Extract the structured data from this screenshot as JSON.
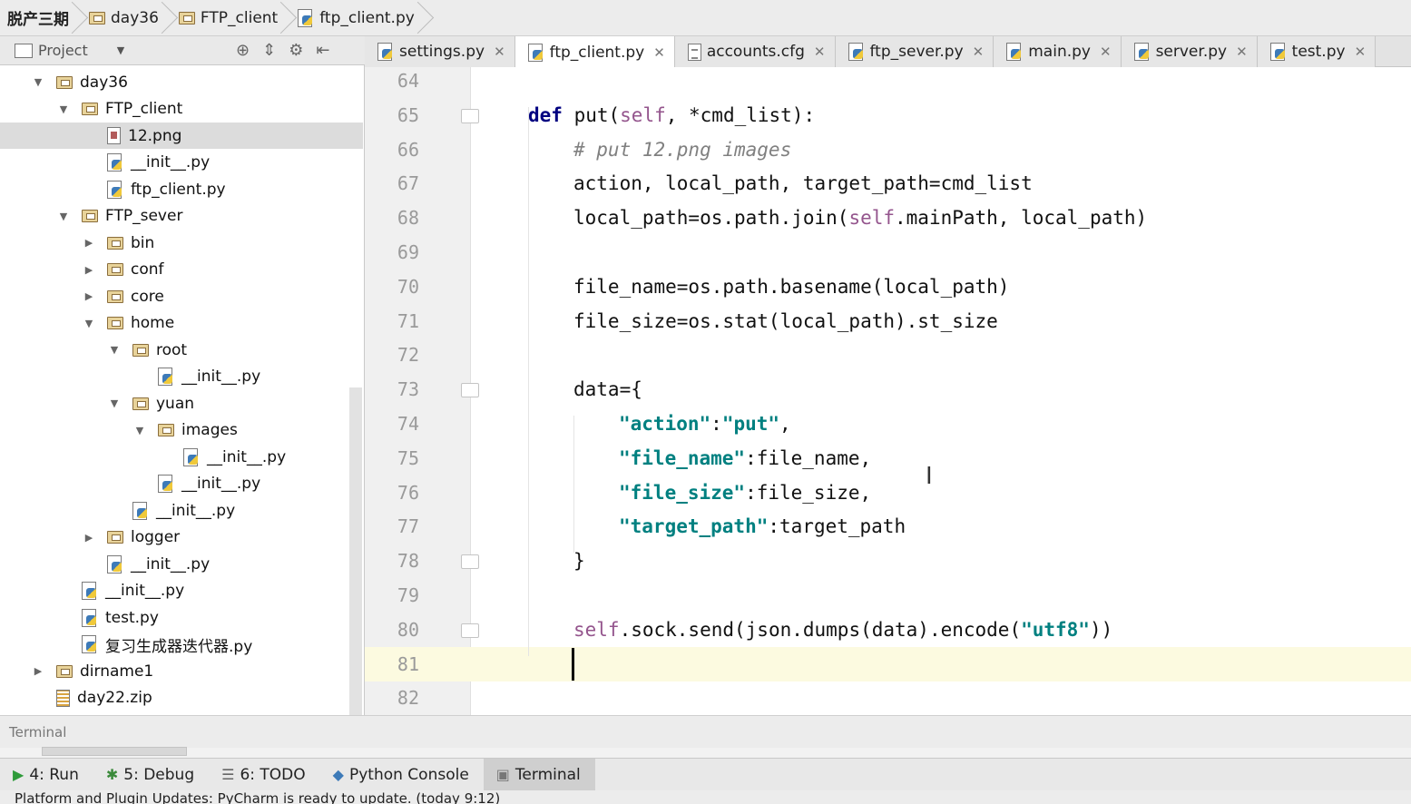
{
  "breadcrumb": [
    "脱产三期",
    "day36",
    "FTP_client",
    "ftp_client.py"
  ],
  "project_panel": {
    "title": "Project",
    "tree": [
      {
        "label": "day36",
        "type": "folder",
        "depth": 0,
        "expanded": true
      },
      {
        "label": "FTP_client",
        "type": "folder",
        "depth": 1,
        "expanded": true
      },
      {
        "label": "12.png",
        "type": "image",
        "depth": 2,
        "selected": true
      },
      {
        "label": "__init__.py",
        "type": "py",
        "depth": 2
      },
      {
        "label": "ftp_client.py",
        "type": "py",
        "depth": 2
      },
      {
        "label": "FTP_sever",
        "type": "folder",
        "depth": 1,
        "expanded": true
      },
      {
        "label": "bin",
        "type": "folder",
        "depth": 2,
        "expanded": false
      },
      {
        "label": "conf",
        "type": "folder",
        "depth": 2,
        "expanded": false
      },
      {
        "label": "core",
        "type": "folder",
        "depth": 2,
        "expanded": false
      },
      {
        "label": "home",
        "type": "folder",
        "depth": 2,
        "expanded": true
      },
      {
        "label": "root",
        "type": "folder",
        "depth": 3,
        "expanded": true
      },
      {
        "label": "__init__.py",
        "type": "py",
        "depth": 4
      },
      {
        "label": "yuan",
        "type": "folder",
        "depth": 3,
        "expanded": true
      },
      {
        "label": "images",
        "type": "folder",
        "depth": 4,
        "expanded": true
      },
      {
        "label": "__init__.py",
        "type": "py",
        "depth": 5
      },
      {
        "label": "__init__.py",
        "type": "py",
        "depth": 4
      },
      {
        "label": "__init__.py",
        "type": "py",
        "depth": 3
      },
      {
        "label": "logger",
        "type": "folder",
        "depth": 2,
        "expanded": false
      },
      {
        "label": "__init__.py",
        "type": "py",
        "depth": 2
      },
      {
        "label": "__init__.py",
        "type": "py",
        "depth": 1
      },
      {
        "label": "test.py",
        "type": "py",
        "depth": 1
      },
      {
        "label": "复习生成器迭代器.py",
        "type": "py",
        "depth": 1
      },
      {
        "label": "dirname1",
        "type": "folder",
        "depth": 0,
        "expanded": false
      },
      {
        "label": "day22.zip",
        "type": "zip",
        "depth": 0
      }
    ]
  },
  "tabs": [
    {
      "label": "settings.py",
      "icon": "py",
      "active": false
    },
    {
      "label": "ftp_client.py",
      "icon": "py",
      "active": true
    },
    {
      "label": "accounts.cfg",
      "icon": "cfg",
      "active": false
    },
    {
      "label": "ftp_sever.py",
      "icon": "py",
      "active": false
    },
    {
      "label": "main.py",
      "icon": "py",
      "active": false
    },
    {
      "label": "server.py",
      "icon": "py",
      "active": false
    },
    {
      "label": "test.py",
      "icon": "py",
      "active": false
    }
  ],
  "editor": {
    "lines": [
      {
        "num": "64",
        "tokens": []
      },
      {
        "num": "65",
        "tokens": [
          [
            "kw",
            "def"
          ],
          [
            "t",
            " put("
          ],
          [
            "self",
            "self"
          ],
          [
            "t",
            ", *cmd_list):"
          ]
        ]
      },
      {
        "num": "66",
        "tokens": [
          [
            "cmt",
            "# put 12.png images"
          ]
        ]
      },
      {
        "num": "67",
        "tokens": [
          [
            "t",
            "action, local_path, target_path=cmd_list"
          ]
        ]
      },
      {
        "num": "68",
        "tokens": [
          [
            "t",
            "local_path=os.path.join("
          ],
          [
            "self",
            "self"
          ],
          [
            "t",
            ".mainPath, local_path)"
          ]
        ]
      },
      {
        "num": "69",
        "tokens": []
      },
      {
        "num": "70",
        "tokens": [
          [
            "t",
            "file_name=os.path.basename(local_path)"
          ]
        ]
      },
      {
        "num": "71",
        "tokens": [
          [
            "t",
            "file_size=os.stat(local_path).st_size"
          ]
        ]
      },
      {
        "num": "72",
        "tokens": []
      },
      {
        "num": "73",
        "tokens": [
          [
            "t",
            "data={"
          ]
        ]
      },
      {
        "num": "74",
        "tokens": [
          [
            "str",
            "\"action\""
          ],
          [
            "t",
            ":"
          ],
          [
            "str",
            "\"put\""
          ],
          [
            "t",
            ","
          ]
        ]
      },
      {
        "num": "75",
        "tokens": [
          [
            "str",
            "\"file_name\""
          ],
          [
            "t",
            ":file_name,"
          ]
        ]
      },
      {
        "num": "76",
        "tokens": [
          [
            "str",
            "\"file_size\""
          ],
          [
            "t",
            ":file_size,"
          ]
        ]
      },
      {
        "num": "77",
        "tokens": [
          [
            "str",
            "\"target_path\""
          ],
          [
            "t",
            ":target_path"
          ]
        ]
      },
      {
        "num": "78",
        "tokens": [
          [
            "t",
            "}"
          ]
        ]
      },
      {
        "num": "79",
        "tokens": []
      },
      {
        "num": "80",
        "tokens": [
          [
            "self",
            "self"
          ],
          [
            "t",
            ".sock.send(json.dumps(data).encode("
          ],
          [
            "str",
            "\"utf8\""
          ],
          [
            "t",
            "))"
          ]
        ]
      },
      {
        "num": "81",
        "tokens": [],
        "current": true
      },
      {
        "num": "82",
        "tokens": []
      }
    ]
  },
  "terminal_label": "Terminal",
  "tool_windows": [
    {
      "label": "4: Run",
      "icon": "run-icon",
      "active": false
    },
    {
      "label": "5: Debug",
      "icon": "debug-icon",
      "active": false
    },
    {
      "label": "6: TODO",
      "icon": "todo-icon",
      "active": false
    },
    {
      "label": "Python Console",
      "icon": "python-console-icon",
      "active": false
    },
    {
      "label": "Terminal",
      "icon": "terminal-icon",
      "active": true
    }
  ],
  "status_text": "Platform and Plugin Updates: PyCharm is ready to update. (today 9:12)"
}
